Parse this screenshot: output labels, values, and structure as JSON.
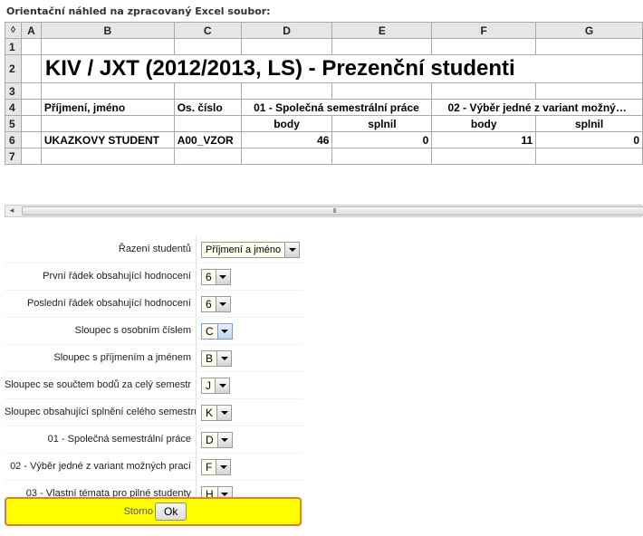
{
  "preview": {
    "title": "Orientační náhled na zpracovaný Excel soubor:"
  },
  "spreadsheet": {
    "corner_symbol": "◊",
    "columns": [
      "A",
      "B",
      "C",
      "D",
      "E",
      "F",
      "G"
    ],
    "row_numbers": [
      "1",
      "2",
      "3",
      "4",
      "5",
      "6",
      "7"
    ],
    "sheet_title": "KIV / JXT (2012/2013, LS) - Prezenční studenti",
    "header": {
      "name": "Příjmení, jméno",
      "id": "Os. číslo",
      "group1": "01 - Společná semestrální práce",
      "group2": "02 - Výběr jedné z variant možný…",
      "sub_points": "body",
      "sub_passed": "splnil"
    },
    "student": {
      "name": "UKAZKOVY STUDENT",
      "id": "A00_VZOR",
      "g1_points": "46",
      "g1_passed": "0",
      "g2_points": "11",
      "g2_passed": "0"
    }
  },
  "scrollbar": {
    "left_arrow": "◂",
    "grip": "III"
  },
  "settings": {
    "rows": [
      {
        "label": "Řazení studentů",
        "value": "Příjmení a jméno"
      },
      {
        "label": "První řádek obsahující hodnocení",
        "value": "6"
      },
      {
        "label": "Poslední řádek obsahující hodnocení",
        "value": "6"
      },
      {
        "label": "Sloupec s osobním číslem",
        "value": "C"
      },
      {
        "label": "Sloupec s příjmením a jménem",
        "value": "B"
      },
      {
        "label": "Sloupec se součtem bodů za celý semestr",
        "value": "J"
      },
      {
        "label": "Sloupec obsahující splnění celého semestru",
        "value": "K"
      },
      {
        "label": "01 - Společná semestrální práce",
        "value": "D"
      },
      {
        "label": "02 - Výběr jedné z variant možných prací",
        "value": "F"
      },
      {
        "label": "03 - Vlastní témata pro pilné studenty",
        "value": "H"
      }
    ]
  },
  "footer": {
    "storno_label": "Storno",
    "ok_label": "Ok"
  },
  "colors": {
    "footer_background": "#ffff00",
    "footer_border": "#e77b2c",
    "header_cell": "#e6e6e6"
  }
}
